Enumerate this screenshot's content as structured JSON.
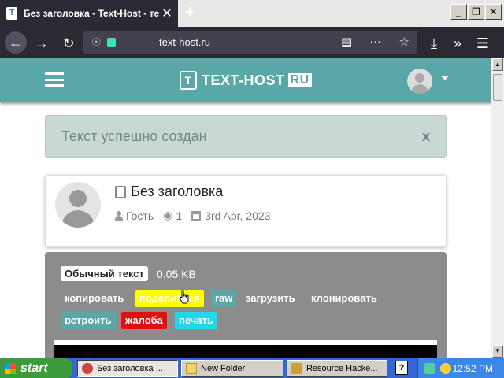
{
  "browser": {
    "tab_title": "Без заголовка - Text-Host - текс",
    "tab_favicon": "T",
    "tab_close": "✕",
    "new_tab": "+",
    "url": "text-host.ru",
    "window_buttons": [
      "_",
      "❐",
      "✕"
    ]
  },
  "site": {
    "logo_mark": "T",
    "logo_text": "TEXT-HOST",
    "logo_ru": "RU",
    "alert_message": "Текст успешно создан",
    "alert_close": "x",
    "doc_title": "Без заголовка",
    "author": "Гость",
    "views": "1",
    "date": "3rd Apr, 2023",
    "type_badge": "Обычный текст",
    "size": "0.05 KB",
    "actions": [
      {
        "label": "копировать",
        "color": "#8c8c8c"
      },
      {
        "label": "поделиться",
        "color": "#ffff00"
      },
      {
        "label": "raw",
        "color": "#5aa7a7"
      },
      {
        "label": "загрузить",
        "color": "#8c8c8c"
      },
      {
        "label": "клонировать",
        "color": "#8c8c8c"
      },
      {
        "label": "встроить",
        "color": "#5aa7a7"
      },
      {
        "label": "жалоба",
        "color": "#e01010"
      },
      {
        "label": "печать",
        "color": "#20d8e8"
      }
    ],
    "accent_color": "#5aa7a7"
  },
  "taskbar": {
    "start_label": "start",
    "tasks": [
      "Без заголовка ...",
      "New Folder",
      "Resource Hacke..."
    ],
    "help_icon": "?",
    "clock": "12:52 PM"
  }
}
